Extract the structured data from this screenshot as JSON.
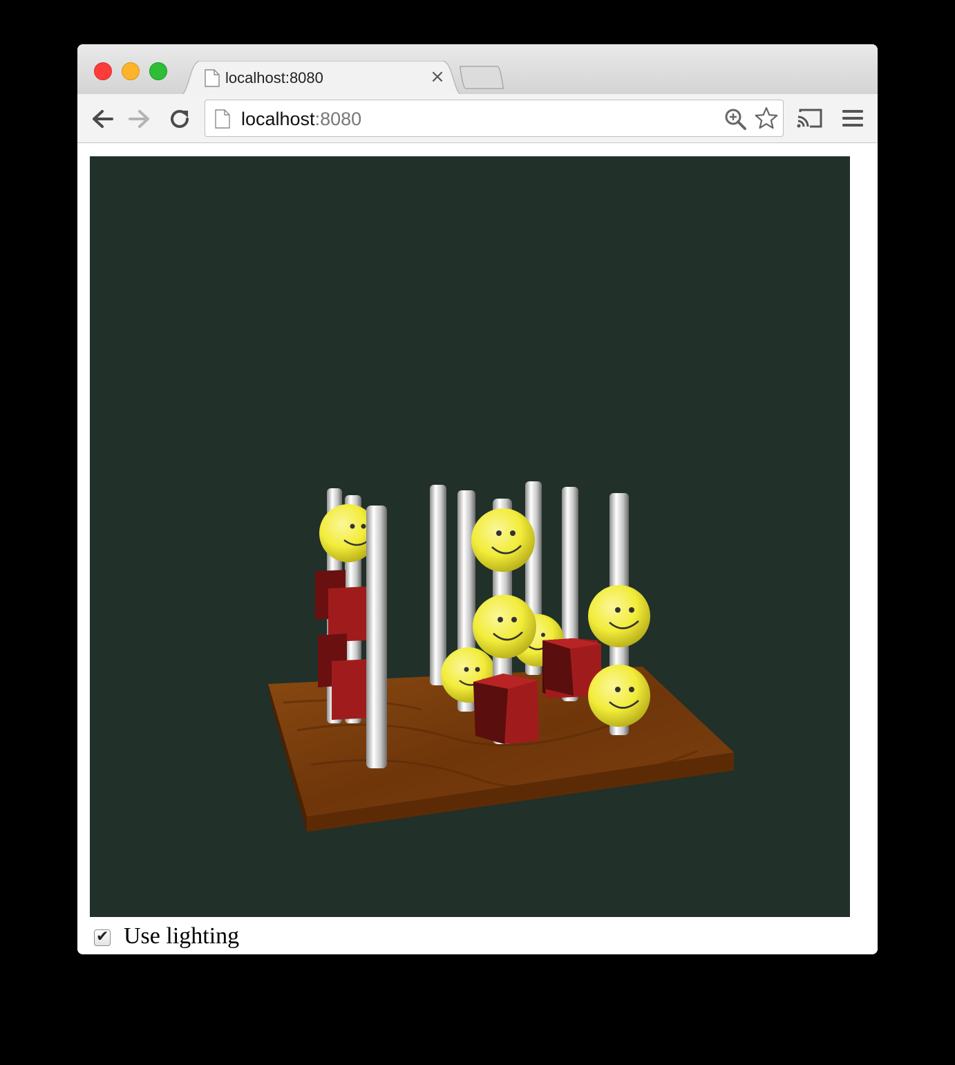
{
  "browser": {
    "tab": {
      "title": "localhost:8080",
      "close_glyph": "×"
    },
    "omnibox": {
      "host": "localhost",
      "port": ":8080"
    },
    "icons": [
      "back-icon",
      "forward-icon",
      "reload-icon",
      "page-icon",
      "zoom-icon",
      "star-icon",
      "cast-icon",
      "menu-icon"
    ]
  },
  "page": {
    "scene": {
      "background": "#213028",
      "board_color": "#7a3d0c",
      "cube_color": "#9c1c1c",
      "smiley_color": "#f2ec3a",
      "pole_color": "#d8d8d8"
    },
    "lighting_checkbox": {
      "label": "Use lighting",
      "checked": true,
      "glyph": "✔"
    }
  }
}
